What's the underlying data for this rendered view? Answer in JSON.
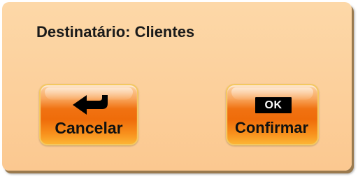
{
  "dialog": {
    "title": "Destinatário: Clientes",
    "background_color": "#fbc890",
    "buttons": {
      "cancel": {
        "label": "Cancelar",
        "icon": "return-arrow-icon"
      },
      "confirm": {
        "label": "Confirmar",
        "icon": "ok-icon",
        "icon_text": "OK"
      }
    },
    "button_color": "#ef6c0a"
  }
}
